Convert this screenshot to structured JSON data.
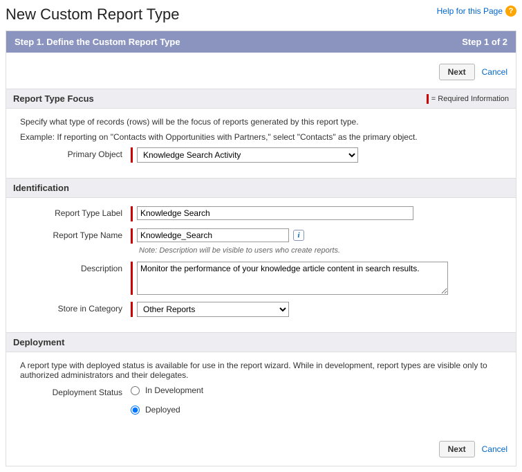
{
  "header": {
    "title": "New Custom Report Type",
    "help_link": "Help for this Page"
  },
  "step_bar": {
    "left": "Step 1. Define the Custom Report Type",
    "right": "Step 1 of 2"
  },
  "buttons": {
    "next": "Next",
    "cancel": "Cancel"
  },
  "focus": {
    "heading": "Report Type Focus",
    "required_legend": "= Required Information",
    "intro": "Specify what type of records (rows) will be the focus of reports generated by this report type.",
    "example": "Example: If reporting on \"Contacts with Opportunities with Partners,\" select \"Contacts\" as the primary object.",
    "primary_object_label": "Primary Object",
    "primary_object_value": "Knowledge Search Activity"
  },
  "identification": {
    "heading": "Identification",
    "label_label": "Report Type Label",
    "label_value": "Knowledge Search",
    "name_label": "Report Type Name",
    "name_value": "Knowledge_Search",
    "note": "Note: Description will be visible to users who create reports.",
    "description_label": "Description",
    "description_value": "Monitor the performance of your knowledge article content in search results.",
    "category_label": "Store in Category",
    "category_value": "Other Reports"
  },
  "deployment": {
    "heading": "Deployment",
    "intro": "A report type with deployed status is available for use in the report wizard. While in development, report types are visible only to authorized administrators and their delegates.",
    "status_label": "Deployment Status",
    "option_dev": "In Development",
    "option_deployed": "Deployed",
    "selected": "deployed"
  }
}
